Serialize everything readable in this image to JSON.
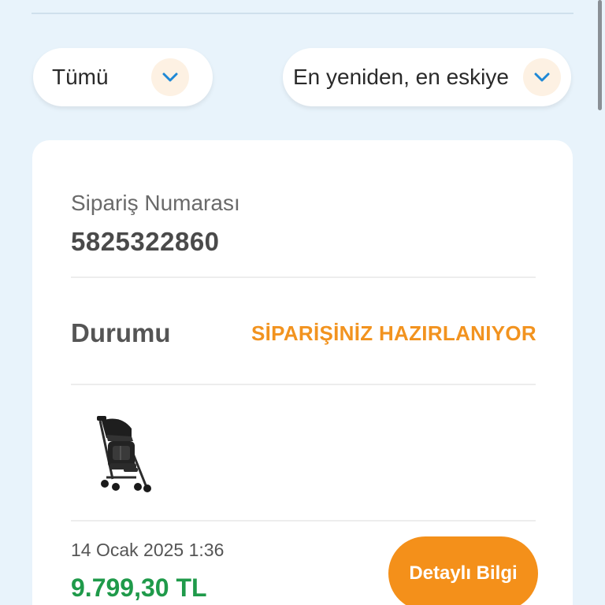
{
  "filters": {
    "status": {
      "label": "Tümü",
      "icon": "chevron-down-icon"
    },
    "sort": {
      "label": "En yeniden, en eskiye",
      "icon": "chevron-down-icon"
    }
  },
  "order": {
    "number_label": "Sipariş Numarası",
    "number": "5825322860",
    "status_label": "Durumu",
    "status_value": "SİPARİŞİNİZ HAZIRLANIYOR",
    "product_image": "stroller-image",
    "date": "14 Ocak 2025 1:36",
    "price": "9.799,30 TL",
    "detail_button": "Detaylı Bilgi"
  },
  "colors": {
    "background": "#e8f3fb",
    "accent_orange": "#f4901a",
    "status_orange": "#f2931f",
    "price_green": "#1f9a4a",
    "chevron_blue": "#1e88d6"
  }
}
